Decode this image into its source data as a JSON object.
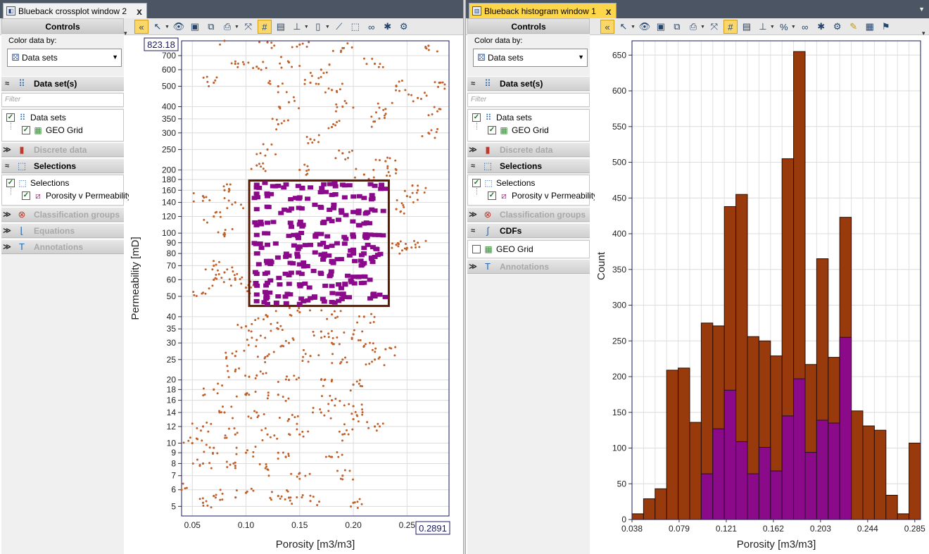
{
  "colors": {
    "tab_active": "#fdd64a",
    "point_color": "#c0602a",
    "selected_color": "#8b0a8b",
    "bar_total": "#983a0b",
    "bar_selected": "#8a0a8a",
    "selection_box": "#5a1a00"
  },
  "left_window": {
    "tab_title": "Blueback crossplot window 2",
    "tab_close": "x",
    "controls_title": "Controls",
    "color_label": "Color data by:",
    "color_value": "Data sets",
    "filter_placeholder": "Filter",
    "sections": {
      "datasets": "Data set(s)",
      "discrete": "Discrete data",
      "selections": "Selections",
      "classification": "Classification groups",
      "equations": "Equations",
      "annotations": "Annotations"
    },
    "tree_datasets": {
      "root": "Data sets",
      "child": "GEO Grid"
    },
    "tree_selections": {
      "root": "Selections",
      "child": "Porosity v Permeability"
    }
  },
  "right_window": {
    "tab_title": "Blueback histogram window 1",
    "tab_close": "x",
    "controls_title": "Controls",
    "color_label": "Color data by:",
    "color_value": "Data sets",
    "filter_placeholder": "Filter",
    "sections": {
      "datasets": "Data set(s)",
      "discrete": "Discrete data",
      "selections": "Selections",
      "classification": "Classification groups",
      "cdfs": "CDFs",
      "annotations": "Annotations"
    },
    "tree_datasets": {
      "root": "Data sets",
      "child": "GEO Grid"
    },
    "tree_selections": {
      "root": "Selections",
      "child": "Porosity v Permeability"
    },
    "tree_cdfs": {
      "child": "GEO Grid"
    }
  },
  "chart_data": [
    {
      "type": "scatter",
      "title": "",
      "xlabel": "Porosity [m3/m3]",
      "ylabel": "Permeability [mD]",
      "x_log": false,
      "y_log": true,
      "xlim": [
        0.04,
        0.2891
      ],
      "ylim": [
        4.5,
        823.18
      ],
      "x_ticks": [
        "0.05",
        "0.10",
        "0.15",
        "0.20",
        "0.25"
      ],
      "x_tick_values": [
        0.05,
        0.1,
        0.15,
        0.2,
        0.25
      ],
      "y_ticks": [
        "5",
        "6",
        "7",
        "8",
        "9",
        "10",
        "12",
        "14",
        "16",
        "18",
        "20",
        "25",
        "30",
        "35",
        "40",
        "50",
        "60",
        "70",
        "80",
        "90",
        "100",
        "120",
        "140",
        "160",
        "180",
        "200",
        "250",
        "300",
        "350",
        "400",
        "500",
        "600",
        "700"
      ],
      "y_tick_values": [
        5,
        6,
        7,
        8,
        9,
        10,
        12,
        14,
        16,
        18,
        20,
        25,
        30,
        35,
        40,
        50,
        60,
        70,
        80,
        90,
        100,
        120,
        140,
        160,
        180,
        200,
        250,
        300,
        350,
        400,
        500,
        600,
        700
      ],
      "x_max_readout": "0.2891",
      "y_max_readout": "823.18",
      "grid": true,
      "selection": {
        "name": "Porosity v Permeability",
        "x_range": [
          0.103,
          0.233
        ],
        "y_range": [
          45,
          178
        ]
      },
      "series": [
        {
          "name": "GEO Grid",
          "points": [
            [
              0.08,
              823
            ],
            [
              0.12,
              810
            ],
            [
              0.15,
              790
            ],
            [
              0.19,
              760
            ],
            [
              0.27,
              780
            ],
            [
              0.09,
              640
            ],
            [
              0.11,
              620
            ],
            [
              0.14,
              650
            ],
            [
              0.17,
              600
            ],
            [
              0.22,
              640
            ],
            [
              0.07,
              520
            ],
            [
              0.13,
              500
            ],
            [
              0.16,
              520
            ],
            [
              0.18,
              480
            ],
            [
              0.24,
              500
            ],
            [
              0.28,
              520
            ],
            [
              0.26,
              440
            ],
            [
              0.14,
              420
            ],
            [
              0.19,
              400
            ],
            [
              0.23,
              390
            ],
            [
              0.28,
              390
            ],
            [
              0.13,
              330
            ],
            [
              0.18,
              320
            ],
            [
              0.22,
              340
            ],
            [
              0.27,
              300
            ],
            [
              0.16,
              280
            ],
            [
              0.12,
              250
            ],
            [
              0.19,
              240
            ],
            [
              0.23,
              220
            ],
            [
              0.11,
              210
            ],
            [
              0.15,
              200
            ],
            [
              0.21,
              190
            ],
            [
              0.24,
              200
            ],
            [
              0.08,
              160
            ],
            [
              0.06,
              150
            ],
            [
              0.09,
              140
            ],
            [
              0.25,
              150
            ],
            [
              0.26,
              160
            ],
            [
              0.24,
              130
            ],
            [
              0.07,
              120
            ],
            [
              0.08,
              100
            ],
            [
              0.24,
              88
            ],
            [
              0.26,
              90
            ],
            [
              0.25,
              85
            ],
            [
              0.07,
              70
            ],
            [
              0.08,
              65
            ],
            [
              0.09,
              60
            ],
            [
              0.1,
              55
            ],
            [
              0.07,
              60
            ],
            [
              0.06,
              52
            ],
            [
              0.12,
              40
            ],
            [
              0.15,
              42
            ],
            [
              0.18,
              41
            ],
            [
              0.21,
              40
            ],
            [
              0.1,
              36
            ],
            [
              0.13,
              35
            ],
            [
              0.17,
              34
            ],
            [
              0.2,
              33
            ],
            [
              0.11,
              31
            ],
            [
              0.14,
              30
            ],
            [
              0.18,
              30
            ],
            [
              0.21,
              29
            ],
            [
              0.23,
              28
            ],
            [
              0.09,
              26
            ],
            [
              0.12,
              26
            ],
            [
              0.16,
              26
            ],
            [
              0.19,
              25
            ],
            [
              0.22,
              25
            ],
            [
              0.09,
              22
            ],
            [
              0.11,
              21
            ],
            [
              0.14,
              20
            ],
            [
              0.18,
              20
            ],
            [
              0.2,
              19
            ],
            [
              0.07,
              18
            ],
            [
              0.1,
              17
            ],
            [
              0.13,
              17
            ],
            [
              0.18,
              16
            ],
            [
              0.2,
              15
            ],
            [
              0.08,
              14
            ],
            [
              0.11,
              14
            ],
            [
              0.14,
              13
            ],
            [
              0.17,
              14
            ],
            [
              0.2,
              13
            ],
            [
              0.22,
              12
            ],
            [
              0.06,
              12
            ],
            [
              0.09,
              11
            ],
            [
              0.12,
              11
            ],
            [
              0.15,
              11
            ],
            [
              0.19,
              11
            ],
            [
              0.05,
              10
            ],
            [
              0.07,
              9.5
            ],
            [
              0.1,
              9
            ],
            [
              0.13,
              9
            ],
            [
              0.18,
              8.6
            ],
            [
              0.06,
              8
            ],
            [
              0.09,
              7.8
            ],
            [
              0.12,
              7.5
            ],
            [
              0.15,
              7.2
            ],
            [
              0.19,
              7
            ],
            [
              0.04,
              6
            ],
            [
              0.07,
              5.6
            ],
            [
              0.1,
              5.8
            ],
            [
              0.14,
              5.5
            ],
            [
              0.16,
              5.3
            ],
            [
              0.2,
              5.2
            ],
            [
              0.06,
              5.2
            ],
            [
              0.13,
              5.6
            ]
          ]
        },
        {
          "name": "Porosity v Permeability",
          "points": [
            [
              0.11,
              170
            ],
            [
              0.13,
              168
            ],
            [
              0.16,
              165
            ],
            [
              0.19,
              170
            ],
            [
              0.22,
              168
            ],
            [
              0.12,
              150
            ],
            [
              0.15,
              148
            ],
            [
              0.18,
              152
            ],
            [
              0.21,
              147
            ],
            [
              0.11,
              130
            ],
            [
              0.14,
              128
            ],
            [
              0.17,
              132
            ],
            [
              0.2,
              126
            ],
            [
              0.22,
              128
            ],
            [
              0.12,
              112
            ],
            [
              0.15,
              110
            ],
            [
              0.18,
              114
            ],
            [
              0.21,
              111
            ],
            [
              0.11,
              98
            ],
            [
              0.14,
              97
            ],
            [
              0.17,
              99
            ],
            [
              0.2,
              96
            ],
            [
              0.22,
              98
            ],
            [
              0.12,
              88
            ],
            [
              0.15,
              86
            ],
            [
              0.18,
              87
            ],
            [
              0.21,
              85
            ],
            [
              0.11,
              80
            ],
            [
              0.14,
              78
            ],
            [
              0.17,
              79
            ],
            [
              0.2,
              80
            ],
            [
              0.22,
              77
            ],
            [
              0.12,
              72
            ],
            [
              0.15,
              71
            ],
            [
              0.18,
              73
            ],
            [
              0.21,
              72
            ],
            [
              0.11,
              64
            ],
            [
              0.14,
              63
            ],
            [
              0.17,
              64
            ],
            [
              0.2,
              62
            ],
            [
              0.12,
              58
            ],
            [
              0.15,
              57
            ],
            [
              0.18,
              56
            ],
            [
              0.21,
              58
            ],
            [
              0.11,
              51
            ],
            [
              0.13,
              50
            ],
            [
              0.16,
              49
            ],
            [
              0.19,
              51
            ],
            [
              0.22,
              50
            ],
            [
              0.12,
              46
            ],
            [
              0.15,
              46
            ],
            [
              0.18,
              47
            ]
          ]
        }
      ]
    },
    {
      "type": "bar",
      "title": "",
      "xlabel": "Porosity [m3/m3]",
      "ylabel": "Count",
      "xlim": [
        0.038,
        0.2891
      ],
      "ylim": [
        0,
        670
      ],
      "x_ticks": [
        "0.038",
        "0.079",
        "0.121",
        "0.162",
        "0.203",
        "0.244",
        "0.285"
      ],
      "y_ticks": [
        "0",
        "50",
        "100",
        "150",
        "200",
        "250",
        "300",
        "350",
        "400",
        "450",
        "500",
        "550",
        "600",
        "650"
      ],
      "y_tick_values": [
        0,
        50,
        100,
        150,
        200,
        250,
        300,
        350,
        400,
        450,
        500,
        550,
        600,
        650
      ],
      "grid": true,
      "bin_start": 0.038,
      "bin_width": 0.0099,
      "series": [
        {
          "name": "GEO Grid",
          "values": [
            8,
            29,
            43,
            209,
            212,
            136,
            275,
            271,
            438,
            455,
            256,
            250,
            229,
            505,
            655,
            217,
            365,
            227,
            423,
            152,
            131,
            125,
            34,
            8,
            107
          ]
        },
        {
          "name": "Porosity v Permeability",
          "values": [
            0,
            0,
            0,
            0,
            0,
            0,
            64,
            127,
            181,
            109,
            64,
            101,
            68,
            145,
            197,
            94,
            139,
            135,
            255,
            0,
            0,
            0,
            0,
            0,
            0
          ]
        }
      ]
    }
  ]
}
